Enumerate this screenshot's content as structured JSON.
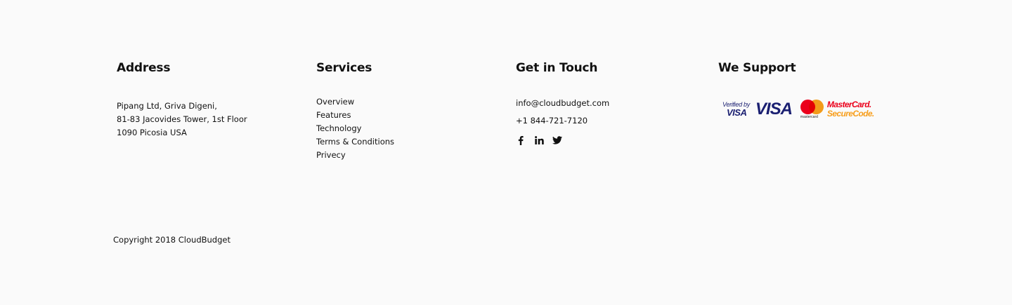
{
  "address": {
    "heading": "Address",
    "lines": [
      "Pipang Ltd, Griva Digeni,",
      "81-83 Jacovides Tower, 1st Floor",
      "1090 Picosia USA"
    ]
  },
  "services": {
    "heading": "Services",
    "items": [
      "Overview",
      "Features",
      "Technology",
      "Terms & Conditions",
      "Privecy"
    ]
  },
  "contact": {
    "heading": "Get in Touch",
    "email": "info@cloudbudget.com",
    "phone": "+1 844-721-7120",
    "social_icons": [
      "facebook-icon",
      "linkedin-icon",
      "twitter-icon"
    ]
  },
  "support": {
    "heading": "We Support",
    "logos": {
      "verified_by": "Verified by",
      "verified_visa": "VISA",
      "visa": "VISA",
      "mastercard_small": "mastercard",
      "mastercard": "MasterCard.",
      "securecode": "SecureCode."
    }
  },
  "copyright": "Copyright 2018 CloudBudget",
  "colors": {
    "background": "#fafafa",
    "text": "#111111",
    "visa_blue": "#1a1f71",
    "mc_red": "#eb001b",
    "mc_orange": "#f79e1b"
  }
}
